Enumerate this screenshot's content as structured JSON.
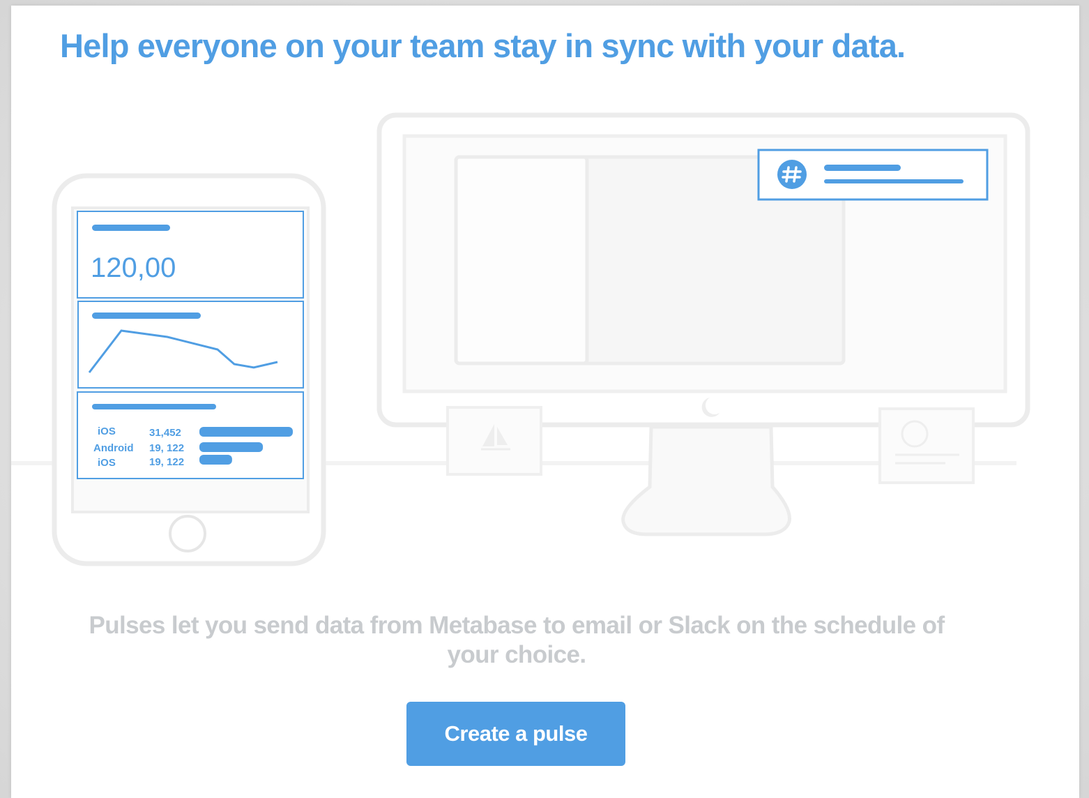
{
  "headline": "Help everyone on your team stay in sync with your data.",
  "illustration": {
    "phone": {
      "scalar_value": "120,00",
      "bar_rows": [
        {
          "label": "iOS",
          "value": "31,452",
          "fill": 1.0
        },
        {
          "label": "Android",
          "value": "19, 122",
          "fill": 0.68
        },
        {
          "label": "iOS",
          "value": "19, 122",
          "fill": 0.35
        }
      ],
      "line_points": [
        0.0,
        1.0,
        0.85,
        0.55,
        0.2,
        0.12,
        0.25
      ]
    },
    "slack_notification_icon": "slack-hash-icon"
  },
  "description": "Pulses let you send data from Metabase to email or Slack on the schedule of your choice.",
  "create_button_label": "Create a pulse",
  "colors": {
    "brand": "#509ee3",
    "outline": "#ededed",
    "muted_text": "#c8cbce"
  }
}
